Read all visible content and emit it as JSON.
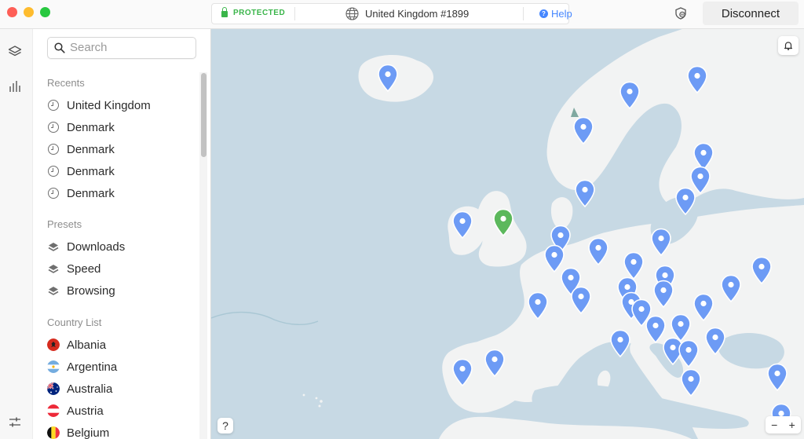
{
  "window": {
    "status": "PROTECTED",
    "server": "United Kingdom #1899",
    "help_label": "Help",
    "disconnect_label": "Disconnect"
  },
  "sidebar": {
    "search_placeholder": "Search",
    "recents_label": "Recents",
    "recents": [
      "United Kingdom",
      "Denmark",
      "Denmark",
      "Denmark",
      "Denmark"
    ],
    "presets_label": "Presets",
    "presets": [
      "Downloads",
      "Speed",
      "Browsing"
    ],
    "country_list_label": "Country List",
    "countries": [
      "Albania",
      "Argentina",
      "Australia",
      "Austria",
      "Belgium"
    ]
  },
  "map": {
    "help_label": "?",
    "zoom_out_label": "−",
    "zoom_in_label": "+",
    "connected_color": "#5cb85c",
    "server_color": "#6d9bf5"
  },
  "colors": {
    "protected_green": "#3ab54a",
    "accent_blue": "#4687ff",
    "sea": "#c7d9e4",
    "land": "#f2f3f3"
  }
}
